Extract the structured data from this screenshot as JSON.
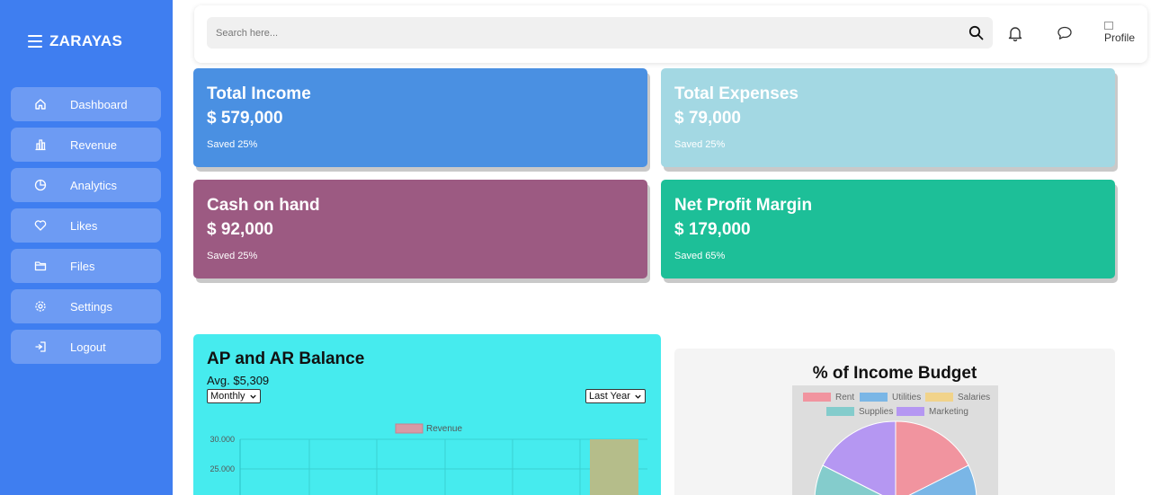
{
  "sidebar": {
    "brand": "ZARAYAS",
    "items": [
      {
        "label": "Dashboard",
        "icon": "home-icon"
      },
      {
        "label": "Revenue",
        "icon": "bar-chart-icon"
      },
      {
        "label": "Analytics",
        "icon": "pie-chart-icon"
      },
      {
        "label": "Likes",
        "icon": "heart-icon"
      },
      {
        "label": "Files",
        "icon": "folder-icon"
      },
      {
        "label": "Settings",
        "icon": "gear-icon"
      },
      {
        "label": "Logout",
        "icon": "logout-icon"
      }
    ]
  },
  "topbar": {
    "search_placeholder": "Search here...",
    "avatar_alt": "Profile"
  },
  "cards": [
    {
      "title": "Total Income",
      "value": "$ 579,000",
      "note": "Saved 25%",
      "color": "#4a90e2"
    },
    {
      "title": "Total Expenses",
      "value": "$ 79,000",
      "note": "Saved 25%",
      "color": "#a3d8e3"
    },
    {
      "title": "Cash on hand",
      "value": "$ 92,000",
      "note": "Saved 25%",
      "color": "#9c5a82"
    },
    {
      "title": "Net Profit Margin",
      "value": "$ 179,000",
      "note": "Saved 65%",
      "color": "#1dbf98"
    }
  ],
  "ap_panel": {
    "title": "AP and AR Balance",
    "avg": "Avg. $5,309",
    "period_select": "Monthly",
    "range_select": "Last Year"
  },
  "budget_panel": {
    "title": "% of Income Budget"
  },
  "chart_data": [
    {
      "type": "bar",
      "legend": [
        "Revenue"
      ],
      "series": [
        {
          "name": "Revenue",
          "color": "#b5bd8a"
        }
      ],
      "yticks": [
        "30.000",
        "25.000"
      ],
      "ylim": [
        0,
        30000
      ],
      "grid": true,
      "legend_position": "top"
    },
    {
      "type": "pie",
      "legend": [
        {
          "label": "Rent",
          "color": "#f1949f"
        },
        {
          "label": "Utilities",
          "color": "#7ab6e6"
        },
        {
          "label": "Salaries",
          "color": "#f1d38a"
        },
        {
          "label": "Supplies",
          "color": "#84cccc"
        },
        {
          "label": "Marketing",
          "color": "#b597f2"
        }
      ],
      "legend_position": "top"
    }
  ]
}
